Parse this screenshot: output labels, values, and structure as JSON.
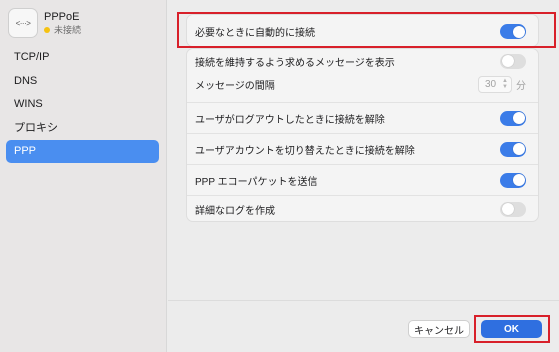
{
  "sidebar": {
    "interface_name": "PPPoE",
    "interface_status": "未接続",
    "interface_icon": "<···>",
    "items": [
      {
        "label": "TCP/IP",
        "active": false
      },
      {
        "label": "DNS",
        "active": false
      },
      {
        "label": "WINS",
        "active": false
      },
      {
        "label": "プロキシ",
        "active": false
      },
      {
        "label": "PPP",
        "active": true
      }
    ]
  },
  "settings": {
    "connect_on_demand": {
      "label": "必要なときに自動的に接続",
      "on": true
    },
    "prompt_keep_connected": {
      "label": "接続を維持するよう求めるメッセージを表示",
      "on": false
    },
    "message_interval": {
      "label": "メッセージの間隔",
      "value": "30",
      "unit": "分"
    },
    "disconnect_on_logout": {
      "label": "ユーザがログアウトしたときに接続を解除",
      "on": true
    },
    "disconnect_on_user_switch": {
      "label": "ユーザアカウントを切り替えたときに接続を解除",
      "on": true
    },
    "send_echo_packets": {
      "label": "PPP エコーパケットを送信",
      "on": true
    },
    "verbose_logging": {
      "label": "詳細なログを作成",
      "on": false
    }
  },
  "footer": {
    "cancel_label": "キャンセル",
    "ok_label": "OK"
  },
  "colors": {
    "accent": "#3b7ce8",
    "highlight": "#d8202a",
    "status_dot": "#f5c211"
  }
}
